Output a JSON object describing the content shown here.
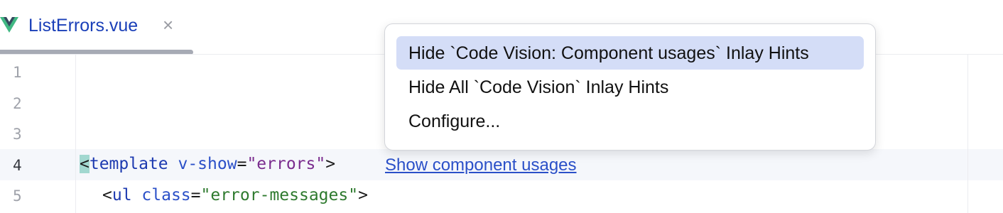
{
  "tab": {
    "filename": "ListErrors.vue",
    "close_glyph": "×",
    "icon": "vue-icon"
  },
  "gutter": {
    "lines": [
      "1",
      "2",
      "3",
      "4",
      "5"
    ],
    "active_line": "4"
  },
  "code": {
    "line4": {
      "open": "<",
      "tag": "template",
      "attr": " v-show",
      "eq": "=",
      "value": "\"errors\"",
      "close": ">"
    },
    "line5": {
      "open": "<",
      "tag": "ul",
      "attr": " class",
      "eq": "=",
      "value": "\"error-messages\"",
      "close": ">"
    }
  },
  "code_vision": {
    "label": "Show component usages"
  },
  "popup_menu": {
    "items": [
      {
        "label": "Hide `Code Vision: Component usages` Inlay Hints",
        "selected": true
      },
      {
        "label": "Hide All `Code Vision` Inlay Hints",
        "selected": false
      },
      {
        "label": "Configure...",
        "selected": false
      }
    ]
  },
  "colors": {
    "tag": "#1d3ab0",
    "string": "#2e7a2e",
    "link": "#2b50c8",
    "menu_selection": "#d4ddf7",
    "bracket_highlight": "#a2d8d0"
  }
}
